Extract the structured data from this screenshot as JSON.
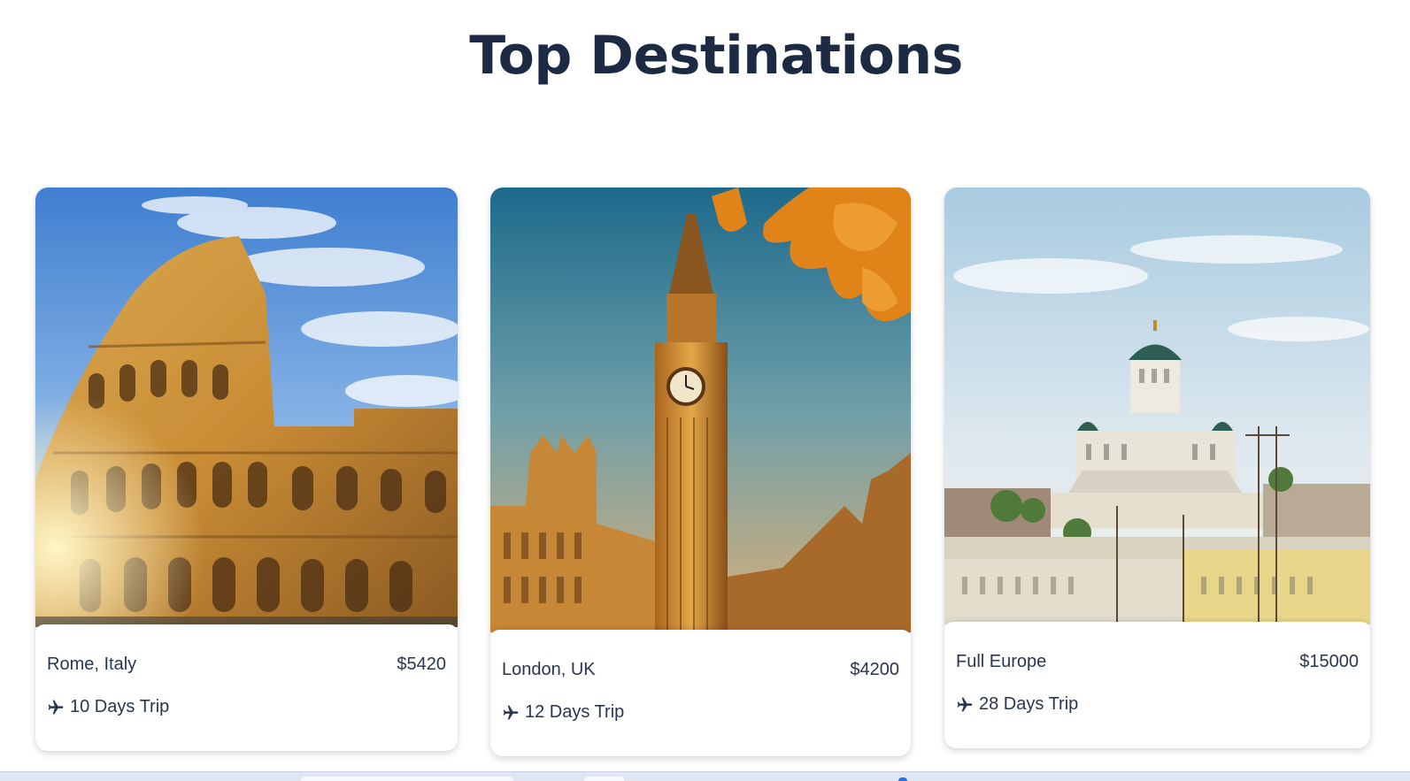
{
  "page": {
    "title": "Top Destinations"
  },
  "destinations": [
    {
      "name": "Rome, Italy",
      "price": "$5420",
      "trip": "10 Days Trip",
      "image": "colosseum-photo"
    },
    {
      "name": "London, UK",
      "price": "$4200",
      "trip": "12 Days Trip",
      "image": "big-ben-photo"
    },
    {
      "name": "Full Europe",
      "price": "$15000",
      "trip": "28 Days Trip",
      "image": "helsinki-cathedral-photo"
    }
  ],
  "colors": {
    "heading": "#1c2a44",
    "text": "#2a3550",
    "card_bg": "#ffffff"
  },
  "icons": {
    "trip": "airplane-icon"
  }
}
